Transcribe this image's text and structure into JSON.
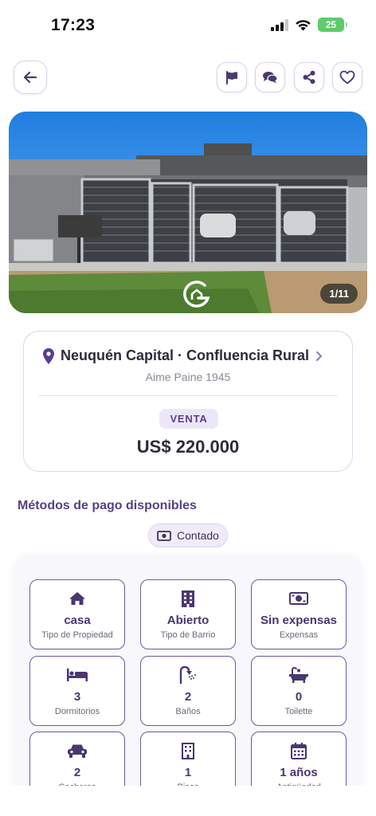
{
  "status": {
    "time": "17:23",
    "battery": "25"
  },
  "header": {
    "back_icon": "arrow-left-icon",
    "actions": [
      "flag-icon",
      "chat-icon",
      "share-icon",
      "heart-icon"
    ]
  },
  "gallery": {
    "counter": "1/11"
  },
  "listing": {
    "location": "Neuquén Capital · Confluencia Rural",
    "address": "Aime Paine 1945",
    "operation": "VENTA",
    "price": "US$ 220.000"
  },
  "payment": {
    "title": "Métodos de pago disponibles",
    "methods": [
      {
        "label": "Contado",
        "icon": "money-icon"
      }
    ]
  },
  "features": [
    {
      "value": "casa",
      "label": "Tipo de Propiedad",
      "icon": "home-icon"
    },
    {
      "value": "Abierto",
      "label": "Tipo de Barrio",
      "icon": "building-icon"
    },
    {
      "value": "Sin expensas",
      "label": "Expensas",
      "icon": "money-icon"
    },
    {
      "value": "3",
      "label": "Dormitorios",
      "icon": "bed-icon"
    },
    {
      "value": "2",
      "label": "Baños",
      "icon": "shower-icon"
    },
    {
      "value": "0",
      "label": "Toilette",
      "icon": "bathtub-icon"
    },
    {
      "value": "2",
      "label": "Cocheras",
      "icon": "car-icon"
    },
    {
      "value": "1",
      "label": "Pisos",
      "icon": "building-icon"
    },
    {
      "value": "1 años",
      "label": "Antigüedad",
      "icon": "calendar-icon"
    }
  ],
  "colors": {
    "accent": "#5b3e8e",
    "border": "#dcd8ea",
    "badge_bg": "#ece7f8"
  }
}
